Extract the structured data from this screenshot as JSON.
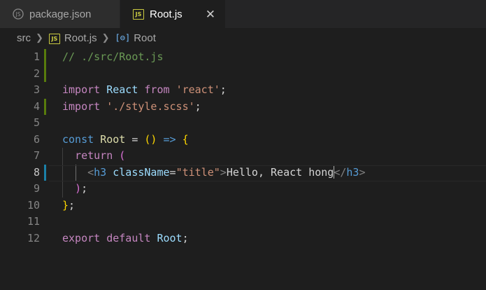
{
  "tabs": [
    {
      "label": "package.json",
      "icon": "json-icon",
      "active": false
    },
    {
      "label": "Root.js",
      "icon": "js-icon",
      "active": true,
      "close": "✕"
    }
  ],
  "breadcrumb": {
    "folder": "src",
    "file": "Root.js",
    "symbol": "Root"
  },
  "editor": {
    "active_line": 8,
    "lines": [
      {
        "n": "1",
        "tokens": [
          [
            "// ./src/Root.js",
            "comment"
          ]
        ]
      },
      {
        "n": "2",
        "tokens": []
      },
      {
        "n": "3",
        "tokens": [
          [
            "import",
            "kw"
          ],
          [
            " ",
            "plain"
          ],
          [
            "React",
            "var"
          ],
          [
            " ",
            "plain"
          ],
          [
            "from",
            "kw"
          ],
          [
            " ",
            "plain"
          ],
          [
            "'react'",
            "str"
          ],
          [
            ";",
            "plain"
          ]
        ]
      },
      {
        "n": "4",
        "tokens": [
          [
            "import",
            "kw"
          ],
          [
            " ",
            "plain"
          ],
          [
            "'./style.scss'",
            "str"
          ],
          [
            ";",
            "plain"
          ]
        ]
      },
      {
        "n": "5",
        "tokens": []
      },
      {
        "n": "6",
        "tokens": [
          [
            "const",
            "decl"
          ],
          [
            " ",
            "plain"
          ],
          [
            "Root",
            "func"
          ],
          [
            " = ",
            "plain"
          ],
          [
            "()",
            "bracket"
          ],
          [
            " ",
            "plain"
          ],
          [
            "=>",
            "decl"
          ],
          [
            " ",
            "plain"
          ],
          [
            "{",
            "bracket"
          ]
        ]
      },
      {
        "n": "7",
        "tokens": [
          [
            "  ",
            "plain"
          ],
          [
            "return",
            "kw"
          ],
          [
            " ",
            "plain"
          ],
          [
            "(",
            "paren2"
          ]
        ]
      },
      {
        "n": "8",
        "tokens": [
          [
            "    ",
            "plain"
          ],
          [
            "<",
            "punct"
          ],
          [
            "h3",
            "tag"
          ],
          [
            " ",
            "plain"
          ],
          [
            "className",
            "attr"
          ],
          [
            "=",
            "plain"
          ],
          [
            "\"title\"",
            "str"
          ],
          [
            ">",
            "punct"
          ],
          [
            "Hello, React hong",
            "plain"
          ],
          [
            "CURSOR",
            "cursor"
          ],
          [
            "</",
            "punct"
          ],
          [
            "h3",
            "tag"
          ],
          [
            ">",
            "punct"
          ]
        ]
      },
      {
        "n": "9",
        "tokens": [
          [
            "  ",
            "plain"
          ],
          [
            ")",
            "paren2"
          ],
          [
            ";",
            "plain"
          ]
        ]
      },
      {
        "n": "10",
        "tokens": [
          [
            "}",
            "bracket"
          ],
          [
            ";",
            "plain"
          ]
        ]
      },
      {
        "n": "11",
        "tokens": []
      },
      {
        "n": "12",
        "tokens": [
          [
            "export",
            "kw"
          ],
          [
            " ",
            "plain"
          ],
          [
            "default",
            "kw"
          ],
          [
            " ",
            "plain"
          ],
          [
            "Root",
            "var"
          ],
          [
            ";",
            "plain"
          ]
        ]
      }
    ],
    "modified_lines": [
      1,
      2,
      4
    ],
    "colors": {
      "background": "#1e1e1e",
      "keyword": "#c586c0",
      "declaration": "#569cd6",
      "string": "#ce9178",
      "comment": "#6a9955",
      "variable": "#9cdcfe",
      "bracket": "#ffd700",
      "gutter_modified": "#587c0c",
      "gutter_active": "#1b81a8"
    }
  }
}
